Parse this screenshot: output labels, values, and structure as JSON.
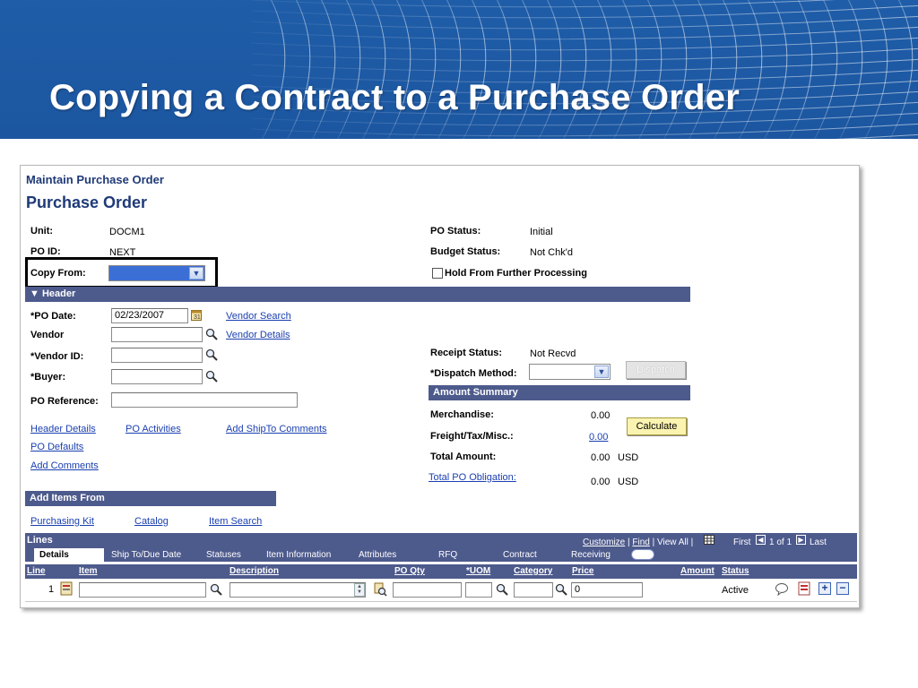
{
  "slide": {
    "title": "Copying a Contract to a Purchase Order"
  },
  "app": {
    "breadcrumb": "Maintain Purchase Order",
    "page_title": "Purchase Order"
  },
  "po_info": {
    "unit_label": "Unit:",
    "unit_value": "DOCM1",
    "po_id_label": "PO ID:",
    "po_id_value": "NEXT",
    "copy_from_label": "Copy From:",
    "po_status_label": "PO Status:",
    "po_status_value": "Initial",
    "budget_status_label": "Budget Status:",
    "budget_status_value": "Not Chk'd",
    "hold_label": "Hold From Further Processing"
  },
  "header_section": {
    "title": "Header",
    "po_date_label": "*PO Date:",
    "po_date_value": "02/23/2007",
    "vendor_label": "Vendor",
    "vendor_id_label": "*Vendor ID:",
    "buyer_label": "*Buyer:",
    "po_reference_label": "PO Reference:",
    "vendor_search_link": "Vendor Search",
    "vendor_details_link": "Vendor Details",
    "receipt_status_label": "Receipt Status:",
    "receipt_status_value": "Not Recvd",
    "dispatch_method_label": "*Dispatch Method:",
    "dispatch_button": "Dispatch",
    "links": {
      "header_details": "Header Details",
      "po_activities": "PO Activities",
      "add_shipto_comments": "Add ShipTo Comments",
      "po_defaults": "PO Defaults",
      "add_comments": "Add Comments"
    }
  },
  "amount_summary": {
    "title": "Amount Summary",
    "merchandise_label": "Merchandise:",
    "merchandise_value": "0.00",
    "freight_label": "Freight/Tax/Misc.:",
    "freight_value": "0.00",
    "total_label": "Total Amount:",
    "total_value": "0.00",
    "total_currency": "USD",
    "obligation_link": "Total PO Obligation:",
    "obligation_value": "0.00",
    "obligation_currency": "USD",
    "calculate_button": "Calculate"
  },
  "add_items": {
    "title": "Add Items From",
    "purchasing_kit": "Purchasing Kit",
    "catalog": "Catalog",
    "item_search": "Item Search"
  },
  "lines": {
    "title": "Lines",
    "customize": "Customize",
    "find": "Find",
    "view_all": "View All",
    "first": "First",
    "range": "1 of 1",
    "last": "Last",
    "tabs": [
      "Details",
      "Ship To/Due Date",
      "Statuses",
      "Item Information",
      "Attributes",
      "RFQ",
      "Contract",
      "Receiving"
    ],
    "columns": [
      "Line",
      "Item",
      "Description",
      "PO Qty",
      "*UOM",
      "Category",
      "Price",
      "Amount",
      "Status"
    ],
    "rows": [
      {
        "line": "1",
        "price": "0",
        "status": "Active"
      }
    ]
  },
  "colors": {
    "banner": "#1f5da8",
    "section_bar": "#4d5a8c",
    "link": "#1a3fb0",
    "title": "#1f3a78"
  }
}
